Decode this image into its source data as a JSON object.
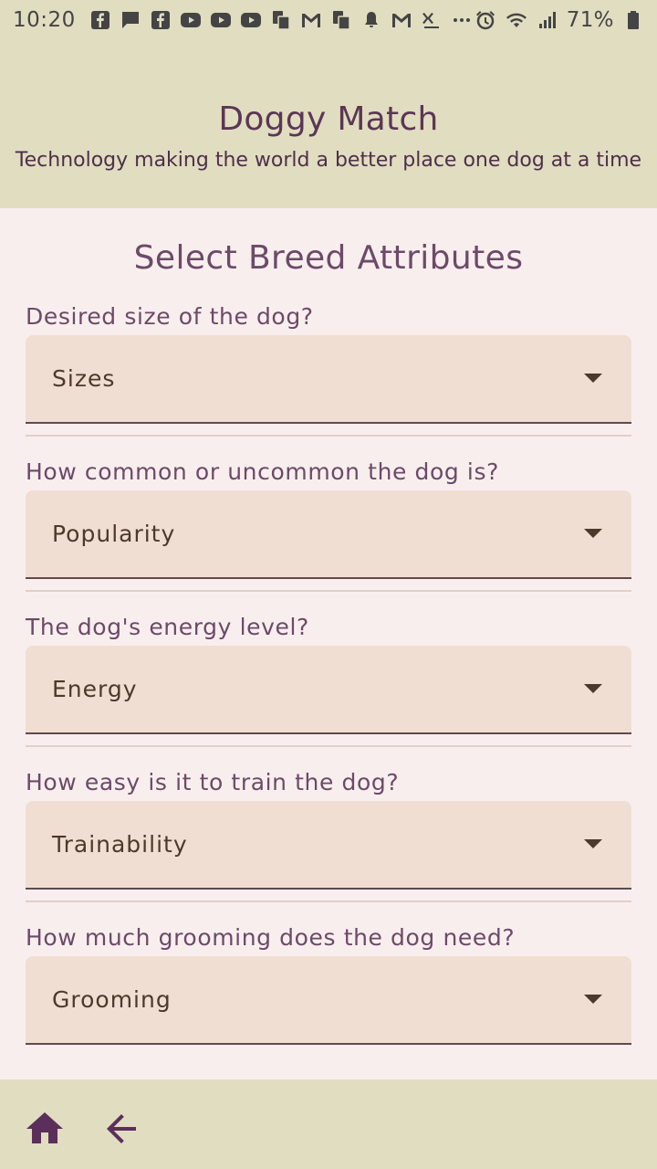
{
  "status_bar": {
    "time": "10:20",
    "icons": [
      "facebook-icon",
      "chat-icon",
      "facebook-icon",
      "youtube-icon",
      "youtube-icon",
      "youtube-icon",
      "copy-icon",
      "gmail-icon",
      "copy-icon",
      "bell-icon",
      "gmail-icon",
      "sleep-icon",
      "more-dots-icon"
    ],
    "battery_percent": "71%",
    "right_icons": [
      "alarm-icon",
      "wifi-icon",
      "signal-icon",
      "battery-icon"
    ]
  },
  "header": {
    "title": "Doggy Match",
    "subtitle": "Technology making the world a better place one dog at a time"
  },
  "main": {
    "section_title": "Select Breed Attributes",
    "fields": [
      {
        "label": "Desired size of the dog?",
        "value": "Sizes"
      },
      {
        "label": "How common or uncommon the dog is?",
        "value": "Popularity"
      },
      {
        "label": "The dog's energy level?",
        "value": "Energy"
      },
      {
        "label": "How easy is it to train the dog?",
        "value": "Trainability"
      },
      {
        "label": "How much grooming does the dog need?",
        "value": "Grooming"
      }
    ]
  },
  "bottom_nav": {
    "items": [
      "home-icon",
      "arrow-left-icon"
    ]
  },
  "colors": {
    "header_bg": "#e1ddc0",
    "page_bg": "#f9eeee",
    "select_bg": "#f1ded2",
    "accent": "#5b2f5b"
  }
}
